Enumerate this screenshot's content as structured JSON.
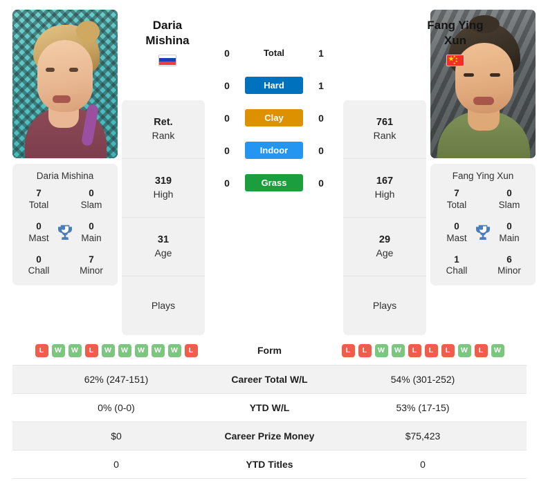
{
  "players": {
    "left": {
      "name_line1": "Daria",
      "name_line2": "Mishina",
      "full_name": "Daria Mishina",
      "country_flag": "russia-flag",
      "rank": "Ret.",
      "rank_label": "Rank",
      "high": "319",
      "high_label": "High",
      "age": "31",
      "age_label": "Age",
      "plays_label": "Plays",
      "plays_value": "",
      "titles": {
        "total": "7",
        "total_label": "Total",
        "slam": "0",
        "slam_label": "Slam",
        "mast": "0",
        "mast_label": "Mast",
        "main": "0",
        "main_label": "Main",
        "chall": "0",
        "chall_label": "Chall",
        "minor": "7",
        "minor_label": "Minor"
      },
      "form": [
        "L",
        "W",
        "W",
        "L",
        "W",
        "W",
        "W",
        "W",
        "W",
        "L"
      ],
      "career_total_wl": "62% (247-151)",
      "ytd_wl": "0% (0-0)",
      "career_prize_money": "$0",
      "ytd_titles": "0"
    },
    "right": {
      "name_line1": "Fang Ying",
      "name_line2": "Xun",
      "full_name": "Fang Ying Xun",
      "country_flag": "china-flag",
      "rank": "761",
      "rank_label": "Rank",
      "high": "167",
      "high_label": "High",
      "age": "29",
      "age_label": "Age",
      "plays_label": "Plays",
      "plays_value": "",
      "titles": {
        "total": "7",
        "total_label": "Total",
        "slam": "0",
        "slam_label": "Slam",
        "mast": "0",
        "mast_label": "Mast",
        "main": "0",
        "main_label": "Main",
        "chall": "1",
        "chall_label": "Chall",
        "minor": "6",
        "minor_label": "Minor"
      },
      "form": [
        "L",
        "L",
        "W",
        "W",
        "L",
        "L",
        "L",
        "W",
        "L",
        "W"
      ],
      "career_total_wl": "54% (301-252)",
      "ytd_wl": "53% (17-15)",
      "career_prize_money": "$75,423",
      "ytd_titles": "0"
    }
  },
  "head_to_head": [
    {
      "label": "Total",
      "left": "0",
      "right": "1",
      "color": "",
      "style": "plain"
    },
    {
      "label": "Hard",
      "left": "0",
      "right": "1",
      "color": "#0071BC",
      "style": "badge"
    },
    {
      "label": "Clay",
      "left": "0",
      "right": "0",
      "color": "#DD9000",
      "style": "badge"
    },
    {
      "label": "Indoor",
      "left": "0",
      "right": "0",
      "color": "#2496F2",
      "style": "badge"
    },
    {
      "label": "Grass",
      "left": "0",
      "right": "0",
      "color": "#1B9E3E",
      "style": "badge"
    }
  ],
  "comparison_rows": [
    {
      "label": "Form",
      "row_type": "form",
      "shaded": false
    },
    {
      "label": "Career Total W/L",
      "row_type": "text",
      "shaded": true,
      "left": "62% (247-151)",
      "right": "54% (301-252)"
    },
    {
      "label": "YTD W/L",
      "row_type": "text",
      "shaded": false,
      "left": "0% (0-0)",
      "right": "53% (17-15)"
    },
    {
      "label": "Career Prize Money",
      "row_type": "text",
      "shaded": true,
      "left": "$0",
      "right": "$75,423"
    },
    {
      "label": "YTD Titles",
      "row_type": "text",
      "shaded": false,
      "left": "0",
      "right": "0"
    }
  ],
  "icons": {
    "trophy": "trophy-icon"
  },
  "colors": {
    "hard": "#0071BC",
    "clay": "#DD9000",
    "indoor": "#2496F2",
    "grass": "#1B9E3E",
    "win": "#7CC67F",
    "loss": "#EF5E4B",
    "panel_bg": "#F1F1F1",
    "row_shade": "#F2F2F2"
  }
}
